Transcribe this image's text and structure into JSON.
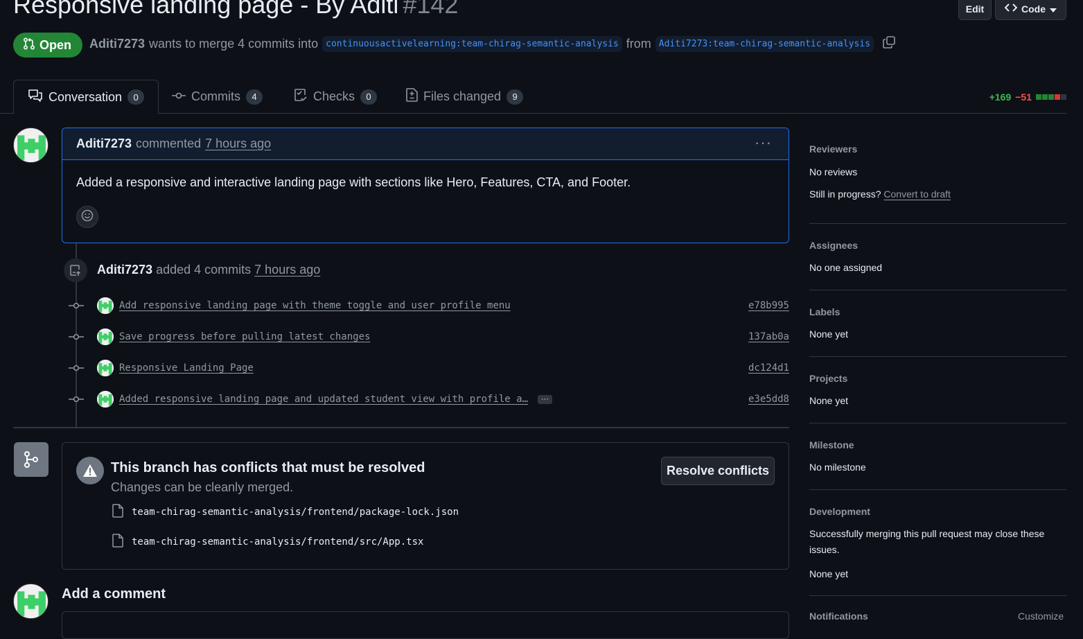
{
  "header": {
    "title": "Responsive landing page - By Aditi",
    "number": "#142",
    "edit_label": "Edit",
    "code_label": "Code"
  },
  "pr": {
    "state": "Open",
    "author": "Aditi7273",
    "merge_text": "wants to merge 4 commits into",
    "base_branch": "continuousactivelearning:team-chirag-semantic-analysis",
    "from_text": "from",
    "head_branch": "Aditi7273:team-chirag-semantic-analysis"
  },
  "tabs": [
    {
      "label": "Conversation",
      "count": "0"
    },
    {
      "label": "Commits",
      "count": "4"
    },
    {
      "label": "Checks",
      "count": "0"
    },
    {
      "label": "Files changed",
      "count": "9"
    }
  ],
  "diffstat": {
    "additions": "+169",
    "deletions": "−51"
  },
  "comment": {
    "author": "Aditi7273",
    "action": "commented",
    "time": "7 hours ago",
    "body": "Added a responsive and interactive landing page with sections like Hero, Features, CTA, and Footer."
  },
  "commits_event": {
    "author": "Aditi7273",
    "action": "added 4 commits",
    "time": "7 hours ago"
  },
  "commits": [
    {
      "message": "Add responsive landing page with theme toggle and user profile menu",
      "sha": "e78b995"
    },
    {
      "message": "Save progress before pulling latest changes",
      "sha": "137ab0a"
    },
    {
      "message": "Responsive Landing Page",
      "sha": "dc124d1"
    },
    {
      "message": "Added responsive landing page and updated student view with profile a…",
      "sha": "e3e5dd8"
    }
  ],
  "merge": {
    "title": "This branch has conflicts that must be resolved",
    "subtitle": "Changes can be cleanly merged.",
    "button": "Resolve conflicts",
    "files": [
      "team-chirag-semantic-analysis/frontend/package-lock.json",
      "team-chirag-semantic-analysis/frontend/src/App.tsx"
    ]
  },
  "add_comment": {
    "title": "Add a comment"
  },
  "sidebar": {
    "reviewers": {
      "heading": "Reviewers",
      "value": "No reviews",
      "draft_prompt": "Still in progress?",
      "draft_link": "Convert to draft"
    },
    "assignees": {
      "heading": "Assignees",
      "value": "No one assigned"
    },
    "labels": {
      "heading": "Labels",
      "value": "None yet"
    },
    "projects": {
      "heading": "Projects",
      "value": "None yet"
    },
    "milestone": {
      "heading": "Milestone",
      "value": "No milestone"
    },
    "development": {
      "heading": "Development",
      "note_line1": "Successfully merging this pull request may close these",
      "note_line2": "issues.",
      "value": "None yet"
    },
    "notifications": {
      "heading": "Notifications",
      "customize": "Customize"
    }
  },
  "colors": {
    "open_green": "#238636",
    "add": "#3fb950",
    "del": "#f85149",
    "link": "#4493f8",
    "accent_border": "#1f6feb"
  }
}
